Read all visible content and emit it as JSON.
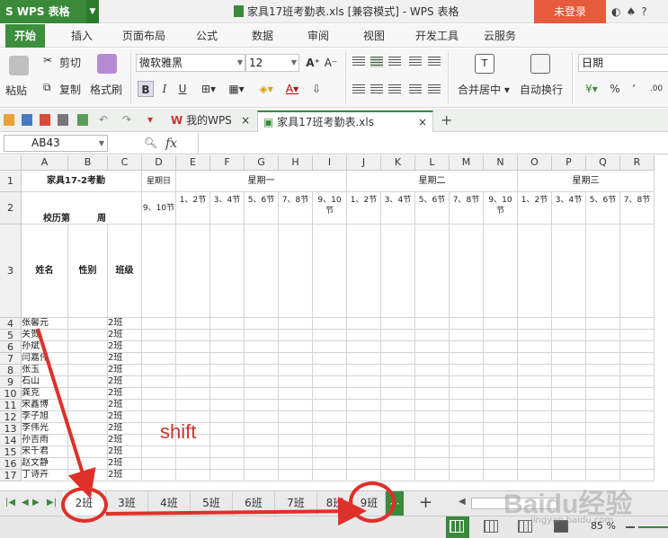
{
  "app": {
    "logo": "S WPS 表格",
    "title": "家具17班考勤表.xls [兼容模式] - WPS 表格",
    "login": "未登录"
  },
  "menu": [
    "开始",
    "插入",
    "页面布局",
    "公式",
    "数据",
    "审阅",
    "视图",
    "开发工具",
    "云服务"
  ],
  "ribbon": {
    "paste": "粘贴",
    "cut": "剪切",
    "copy": "复制",
    "format_painter": "格式刷",
    "font_name": "微软雅黑",
    "font_size": "12",
    "bold": "B",
    "italic": "I",
    "underline": "U",
    "merge_center": "合并居中",
    "wrap_text": "自动换行",
    "number_format": "日期",
    "percent": "%"
  },
  "doc_tabs": [
    {
      "label": "我的WPS"
    },
    {
      "label": "家具17班考勤表.xls"
    }
  ],
  "formula_bar": {
    "cell_ref": "AB43",
    "fx": "fx"
  },
  "columns": [
    "A",
    "B",
    "C",
    "D",
    "E",
    "F",
    "G",
    "H",
    "I",
    "J",
    "K",
    "L",
    "M",
    "N",
    "O",
    "P",
    "Q",
    "R"
  ],
  "rows": [
    "1",
    "2",
    "3",
    "4",
    "5",
    "6",
    "7",
    "8",
    "9",
    "10",
    "11",
    "12",
    "13",
    "14",
    "15",
    "16",
    "17"
  ],
  "sheet": {
    "title": "家具17-2考勤",
    "week_label": "校历第　　　周",
    "day_header": "星期日",
    "weekdays": [
      "星期一",
      "星期二",
      "星期三"
    ],
    "sunday_period": "9、10节",
    "periods": [
      "1、2节",
      "3、4节",
      "5、6节",
      "7、8节",
      "9、10节",
      "1、2节",
      "3、4节",
      "5、6节",
      "7、8节",
      "9、10节",
      "1、2节",
      "3、4节",
      "5、6节",
      "7、8节"
    ],
    "header_name": "姓名",
    "header_gender": "性别",
    "header_class": "班级",
    "students": [
      {
        "name": "张馨元",
        "class": "2班"
      },
      {
        "name": "关贺",
        "class": "2班"
      },
      {
        "name": "孙斌",
        "class": "2班"
      },
      {
        "name": "闫嘉伟",
        "class": "2班"
      },
      {
        "name": "张玉",
        "class": "2班"
      },
      {
        "name": "石山",
        "class": "2班"
      },
      {
        "name": "龚克",
        "class": "2班"
      },
      {
        "name": "宋鑫博",
        "class": "2班"
      },
      {
        "name": "李子旭",
        "class": "2班"
      },
      {
        "name": "李伟光",
        "class": "2班"
      },
      {
        "name": "孙吉雨",
        "class": "2班"
      },
      {
        "name": "宋千君",
        "class": "2班"
      },
      {
        "name": "赵文静",
        "class": "2班"
      },
      {
        "name": "丁诗卉",
        "class": "2班"
      }
    ]
  },
  "sheet_tabs": [
    "2班",
    "3班",
    "4班",
    "5班",
    "6班",
    "7班",
    "8班",
    "9班"
  ],
  "annotation": {
    "shift": "shift"
  },
  "status": {
    "zoom": "85 %"
  },
  "watermark": {
    "main": "Baidu经验",
    "url": "jingyan.baidu.com"
  },
  "colors": {
    "brand_green": "#3a8a3a",
    "login_orange": "#e65b3b",
    "annotation_red": "#e0302a"
  }
}
